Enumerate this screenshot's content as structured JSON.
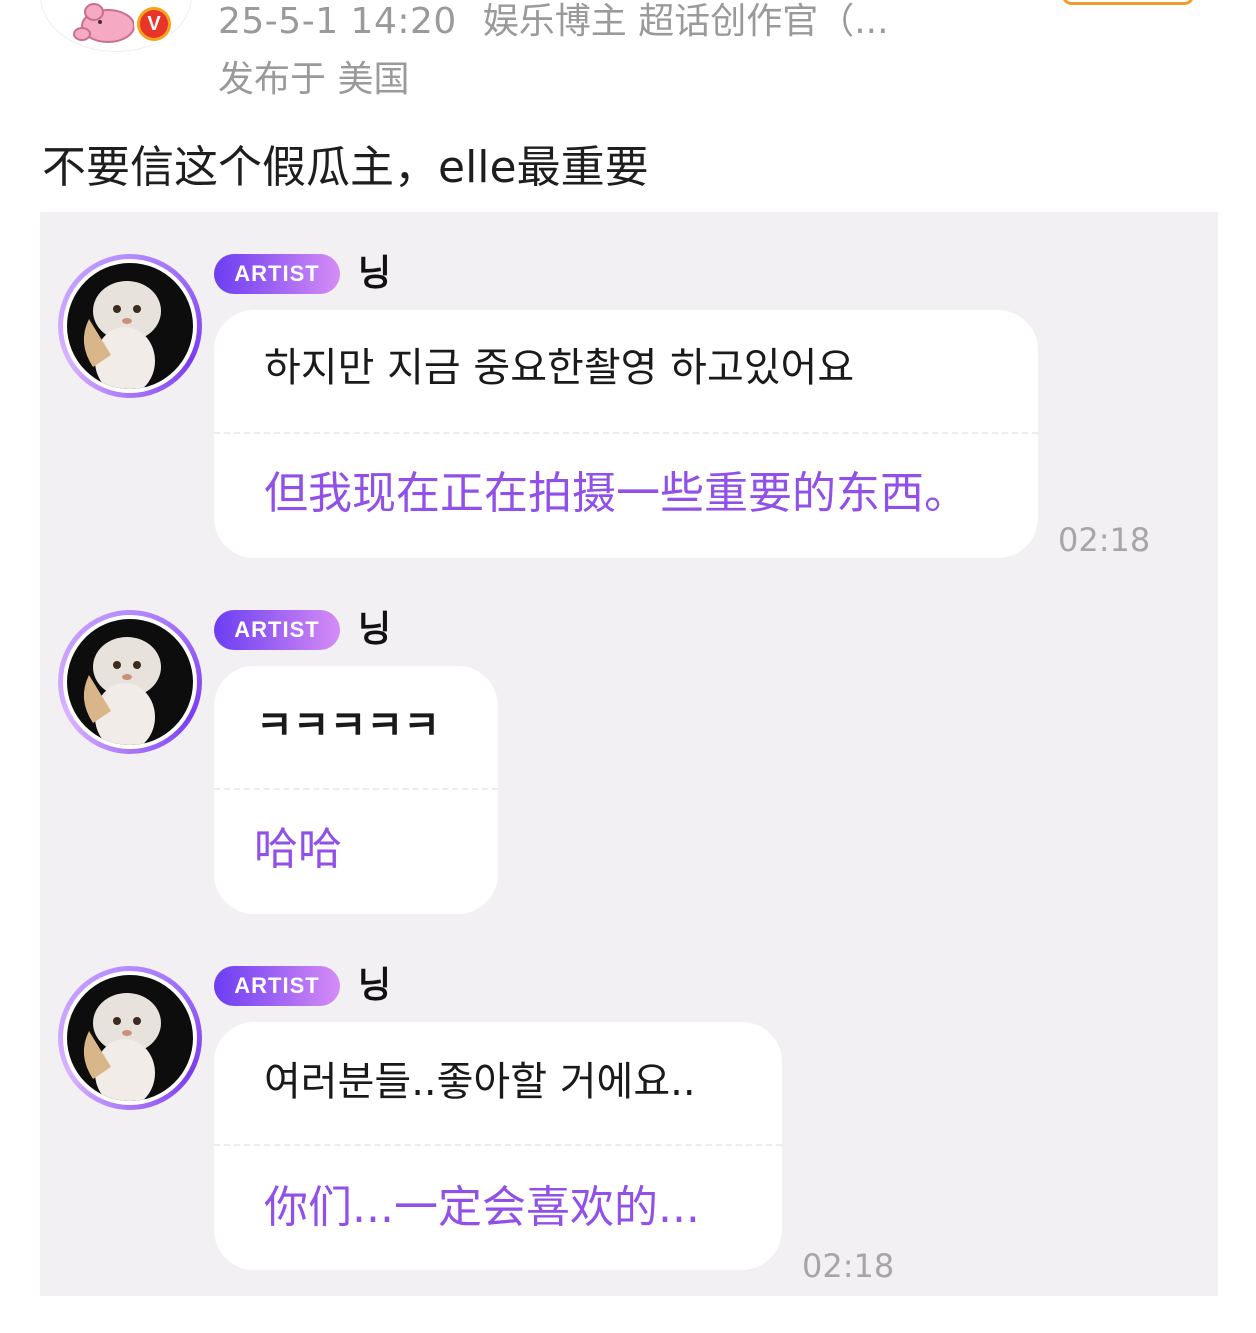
{
  "post": {
    "time": "25-5-1 14:20",
    "tags": "娱乐博主 超话创作官（...",
    "location": "发布于 美国",
    "text": "不要信这个假瓜主，elle最重要",
    "verified_badge": "V"
  },
  "chat": {
    "messages": [
      {
        "badge": "ARTIST",
        "sender": "닝",
        "original": "하지만 지금 중요한촬영 하고있어요",
        "translation": "但我现在正在拍摄一些重要的东西。",
        "time": "02:18"
      },
      {
        "badge": "ARTIST",
        "sender": "닝",
        "original": "ㅋㅋㅋㅋㅋ",
        "translation": "哈哈",
        "time": ""
      },
      {
        "badge": "ARTIST",
        "sender": "닝",
        "original": "여러분들..좋아할 거에요..",
        "translation": "你们...一定会喜欢的...",
        "time": "02:18"
      }
    ]
  },
  "colors": {
    "translation": "#9150e8",
    "badge_start": "#6c3df2",
    "badge_end": "#d58cf5",
    "chat_bg": "#f3f0f3",
    "verified": "#e8352a"
  }
}
